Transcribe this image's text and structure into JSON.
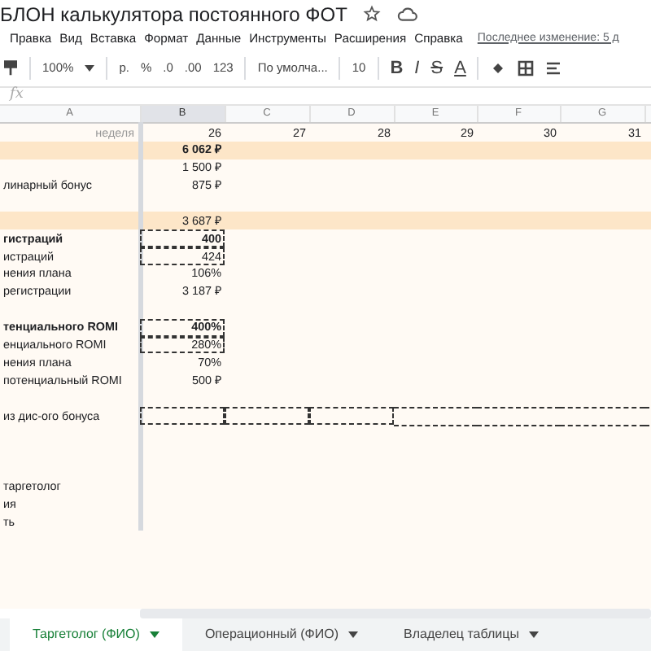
{
  "title": "БЛОН калькулятора постоянного ФОТ",
  "menu": [
    "Правка",
    "Вид",
    "Вставка",
    "Формат",
    "Данные",
    "Инструменты",
    "Расширения",
    "Справка"
  ],
  "last_edit": "Последнее изменение: 5 д",
  "toolbar": {
    "zoom": "100%",
    "currency": "р.",
    "percent": "%",
    "dec_less": ".0",
    "dec_more": ".00",
    "format": "123",
    "font": "По умолча...",
    "size": "10",
    "bold": "B",
    "italic": "I",
    "strike": "S",
    "text_color": "A"
  },
  "formula_label": "fx",
  "columns": [
    {
      "label": "A",
      "selected": false
    },
    {
      "label": "B",
      "selected": true
    },
    {
      "label": "C",
      "selected": false
    },
    {
      "label": "D",
      "selected": false
    },
    {
      "label": "E",
      "selected": false
    },
    {
      "label": "F",
      "selected": false
    },
    {
      "label": "G",
      "selected": false
    }
  ],
  "week_row": {
    "label": "неделя",
    "weeks": [
      "26",
      "27",
      "28",
      "29",
      "30",
      "31"
    ]
  },
  "rows": [
    {
      "band": true,
      "value": "6 062 ₽",
      "bold": true
    },
    {
      "band": false,
      "value": "1 500 ₽"
    },
    {
      "band": false,
      "label": "линарный бонус",
      "value": "875 ₽"
    },
    {
      "band": false
    },
    {
      "band": true,
      "value": "3 687 ₽"
    },
    {
      "band": false,
      "label": "гистраций",
      "value": "400",
      "bold": true,
      "outlined": true
    },
    {
      "band": false,
      "label": "истраций",
      "value": "424",
      "outlined": true
    },
    {
      "band": false,
      "label": "нения плана",
      "value": "106%"
    },
    {
      "band": false,
      "label": "регистрации",
      "value": "3 187 ₽"
    },
    {
      "band": false
    },
    {
      "band": false,
      "label": "тенциального ROMI",
      "value": "400%",
      "bold": true,
      "outlined": true
    },
    {
      "band": false,
      "label": "енциального ROMI",
      "value": "280%",
      "outlined": true
    },
    {
      "band": false,
      "label": "нения плана",
      "value": "70%"
    },
    {
      "band": false,
      "label": "потенциальный ROMI",
      "value": "500 ₽"
    },
    {
      "band": false
    },
    {
      "band": false,
      "label": "из дис-ого бонуса",
      "row_outlined": true
    },
    {
      "band": false
    },
    {
      "band": false
    },
    {
      "band": false
    },
    {
      "band": false,
      "label": "таргетолог"
    },
    {
      "band": false,
      "label": "ия"
    },
    {
      "band": false,
      "label": "ть"
    }
  ],
  "sheets": [
    {
      "label": "Таргетолог (ФИО)",
      "selected": true
    },
    {
      "label": "Операционный (ФИО)",
      "selected": false
    },
    {
      "label": "Владелец таблицы",
      "selected": false
    }
  ]
}
